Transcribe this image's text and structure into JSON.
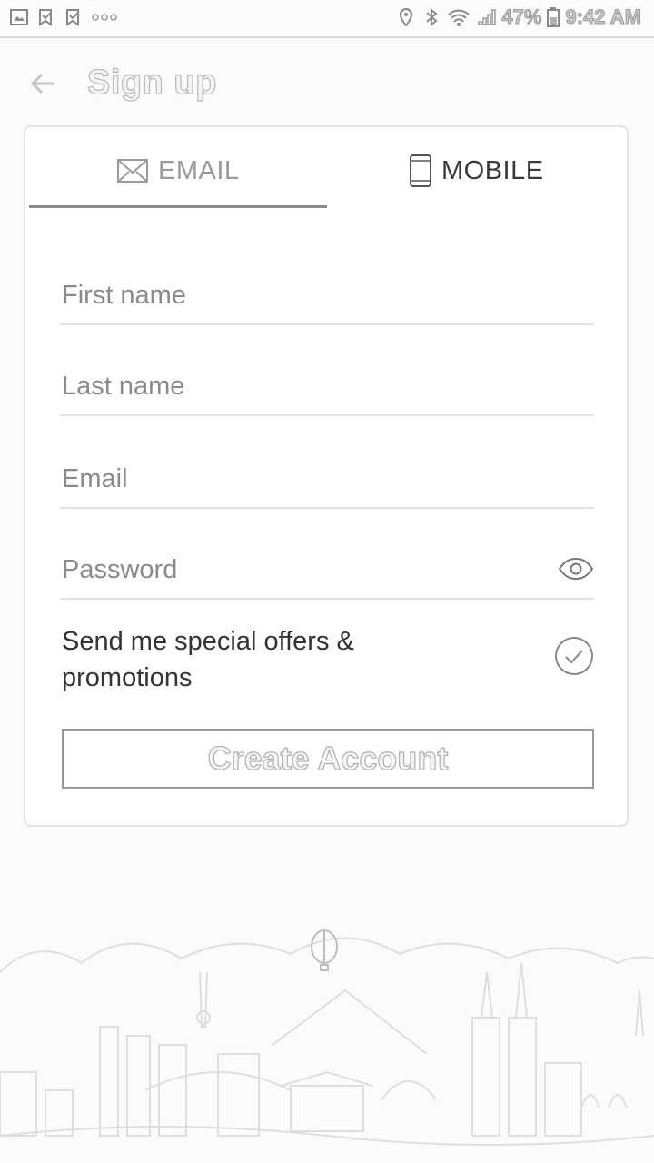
{
  "status_bar": {
    "battery": "47%",
    "time": "9:42 AM"
  },
  "header": {
    "title": "Sign up"
  },
  "tabs": [
    {
      "label": "EMAIL",
      "icon": "envelope-icon",
      "selected": true
    },
    {
      "label": "MOBILE",
      "icon": "phone-icon",
      "selected": false
    }
  ],
  "form": {
    "first_name": {
      "placeholder": "First name",
      "value": ""
    },
    "last_name": {
      "placeholder": "Last name",
      "value": ""
    },
    "email": {
      "placeholder": "Email",
      "value": ""
    },
    "password": {
      "placeholder": "Password",
      "value": ""
    },
    "offers_label": "Send me special offers & promotions",
    "offers_checked": true,
    "submit_label": "Create Account"
  },
  "colors": {
    "tab_selected_underline": "#8a8a8a",
    "border": "#e2e2e2"
  }
}
